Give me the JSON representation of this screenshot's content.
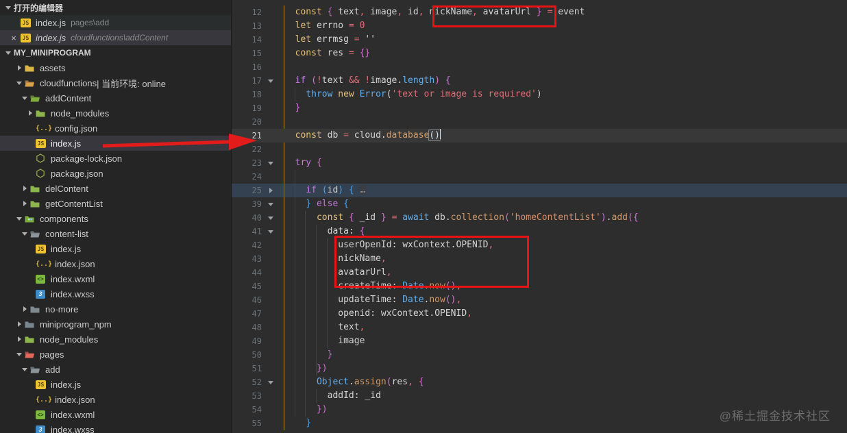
{
  "watermark": "@稀土掘金技术社区",
  "sidebar": {
    "open_editors_header": "打开的编辑器",
    "project_header": "MY_MINIPROGRAM",
    "open_editors": [
      {
        "file": "index.js",
        "path": "pages\\add",
        "icon": "js-file-icon",
        "active": false,
        "close_label": ""
      },
      {
        "file": "index.js",
        "path": "cloudfunctions\\addContent",
        "icon": "js-file-icon",
        "active": true,
        "close_label": "×"
      }
    ],
    "tree": [
      {
        "label": "assets",
        "icon": "folder-icon",
        "color": "#dcb549",
        "indent": 1,
        "chevron": "collapsed"
      },
      {
        "label": "cloudfunctions",
        "suffix": " | 当前环境: online",
        "icon": "folder-open-icon",
        "color": "#d9a04a",
        "indent": 1,
        "chevron": "expanded"
      },
      {
        "label": "addContent",
        "icon": "folder-open-icon",
        "color": "#7fae3e",
        "indent": 2,
        "chevron": "expanded"
      },
      {
        "label": "node_modules",
        "icon": "folder-icon",
        "color": "#8db54e",
        "indent": 3,
        "chevron": "collapsed"
      },
      {
        "label": "config.json",
        "icon": "json-file-icon",
        "indent": 3
      },
      {
        "label": "index.js",
        "icon": "js-file-icon",
        "indent": 3,
        "selected": true
      },
      {
        "label": "package-lock.json",
        "icon": "npm-package-icon",
        "indent": 3
      },
      {
        "label": "package.json",
        "icon": "npm-package-icon",
        "indent": 3
      },
      {
        "label": "delContent",
        "icon": "folder-icon",
        "color": "#8db54e",
        "indent": 2,
        "chevron": "collapsed"
      },
      {
        "label": "getContentList",
        "icon": "folder-icon",
        "color": "#8db54e",
        "indent": 2,
        "chevron": "collapsed"
      },
      {
        "label": "components",
        "icon": "folder-components-icon",
        "color": "#7cae3e",
        "indent": 1,
        "chevron": "expanded"
      },
      {
        "label": "content-list",
        "icon": "folder-open-icon",
        "color": "#8a9499",
        "indent": 2,
        "chevron": "expanded"
      },
      {
        "label": "index.js",
        "icon": "js-file-icon",
        "indent": 3
      },
      {
        "label": "index.json",
        "icon": "json-file-icon",
        "indent": 3
      },
      {
        "label": "index.wxml",
        "icon": "wxml-file-icon",
        "indent": 3
      },
      {
        "label": "index.wxss",
        "icon": "wxss-file-icon",
        "indent": 3
      },
      {
        "label": "no-more",
        "icon": "folder-icon",
        "color": "#7f8a90",
        "indent": 2,
        "chevron": "collapsed"
      },
      {
        "label": "miniprogram_npm",
        "icon": "folder-icon",
        "color": "#77858f",
        "indent": 1,
        "chevron": "collapsed"
      },
      {
        "label": "node_modules",
        "icon": "folder-icon",
        "color": "#8db54e",
        "indent": 1,
        "chevron": "collapsed"
      },
      {
        "label": "pages",
        "icon": "folder-open-icon",
        "color": "#e2695a",
        "indent": 1,
        "chevron": "expanded"
      },
      {
        "label": "add",
        "icon": "folder-open-icon",
        "color": "#8a9499",
        "indent": 2,
        "chevron": "expanded"
      },
      {
        "label": "index.js",
        "icon": "js-file-icon",
        "indent": 3
      },
      {
        "label": "index.json",
        "icon": "json-file-icon",
        "indent": 3
      },
      {
        "label": "index.wxml",
        "icon": "wxml-file-icon",
        "indent": 3
      },
      {
        "label": "index.wxss",
        "icon": "wxss-file-icon",
        "indent": 3
      }
    ]
  },
  "editor": {
    "lines": [
      {
        "n": "12",
        "s": [
          [
            "  ",
            "pl"
          ],
          [
            "const",
            "kw"
          ],
          [
            " ",
            "pl"
          ],
          [
            "{",
            "bp"
          ],
          [
            " text",
            "va"
          ],
          [
            ",",
            "op"
          ],
          [
            " image",
            "va"
          ],
          [
            ",",
            "op"
          ],
          [
            " id",
            "va"
          ],
          [
            ",",
            "op"
          ],
          [
            " nickName",
            "va"
          ],
          [
            ",",
            "op"
          ],
          [
            " avatarUrl ",
            "va"
          ],
          [
            "}",
            "bp"
          ],
          [
            " ",
            "pl"
          ],
          [
            "=",
            "op"
          ],
          [
            " event",
            "va"
          ]
        ]
      },
      {
        "n": "13",
        "s": [
          [
            "  ",
            "pl"
          ],
          [
            "let",
            "kw"
          ],
          [
            " errno ",
            "va"
          ],
          [
            "=",
            "op"
          ],
          [
            " ",
            "pl"
          ],
          [
            "0",
            "op"
          ]
        ]
      },
      {
        "n": "14",
        "s": [
          [
            "  ",
            "pl"
          ],
          [
            "let",
            "kw"
          ],
          [
            " errmsg ",
            "va"
          ],
          [
            "=",
            "op"
          ],
          [
            " ''",
            "va"
          ]
        ]
      },
      {
        "n": "15",
        "s": [
          [
            "  ",
            "pl"
          ],
          [
            "const",
            "kw"
          ],
          [
            " res ",
            "va"
          ],
          [
            "=",
            "op"
          ],
          [
            " ",
            "pl"
          ],
          [
            "{}",
            "bp"
          ]
        ]
      },
      {
        "n": "16",
        "s": []
      },
      {
        "n": "17",
        "fold": "v",
        "s": [
          [
            "  ",
            "pl"
          ],
          [
            "if",
            "kp"
          ],
          [
            " ",
            "pl"
          ],
          [
            "(",
            "bp"
          ],
          [
            "!",
            "op"
          ],
          [
            "text ",
            "va"
          ],
          [
            "&&",
            "op"
          ],
          [
            " ",
            "pl"
          ],
          [
            "!",
            "op"
          ],
          [
            "image",
            "va"
          ],
          [
            ".",
            "va"
          ],
          [
            "length",
            "cl"
          ],
          [
            ")",
            "bp"
          ],
          [
            " ",
            "pl"
          ],
          [
            "{",
            "bp"
          ]
        ]
      },
      {
        "n": "18",
        "s": [
          [
            "    ",
            "pl"
          ],
          [
            "throw",
            "kb"
          ],
          [
            " ",
            "pl"
          ],
          [
            "new",
            "kw"
          ],
          [
            " ",
            "pl"
          ],
          [
            "Error",
            "cl"
          ],
          [
            "(",
            "va"
          ],
          [
            "'text or image is required'",
            "st"
          ],
          [
            ")",
            "va"
          ]
        ]
      },
      {
        "n": "19",
        "s": [
          [
            "  ",
            "pl"
          ],
          [
            "}",
            "bp"
          ]
        ]
      },
      {
        "n": "20",
        "s": []
      },
      {
        "n": "21",
        "current": true,
        "caret": true,
        "s": [
          [
            "  ",
            "pl"
          ],
          [
            "const",
            "kw"
          ],
          [
            " db ",
            "va"
          ],
          [
            "=",
            "op"
          ],
          [
            " cloud",
            "va"
          ],
          [
            ".",
            "va"
          ],
          [
            "database",
            "fn"
          ],
          [
            "()",
            "match"
          ]
        ]
      },
      {
        "n": "22",
        "s": []
      },
      {
        "n": "23",
        "fold": "v",
        "s": [
          [
            "  ",
            "pl"
          ],
          [
            "try",
            "kp"
          ],
          [
            " ",
            "pl"
          ],
          [
            "{",
            "bp"
          ]
        ]
      },
      {
        "n": "24",
        "s": []
      },
      {
        "n": "25",
        "fold": "r",
        "folded": true,
        "s": [
          [
            "    ",
            "pl"
          ],
          [
            "if",
            "kp"
          ],
          [
            " ",
            "pl"
          ],
          [
            "(",
            "bb"
          ],
          [
            "id",
            "va"
          ],
          [
            ")",
            "bb"
          ],
          [
            " ",
            "pl"
          ],
          [
            "{",
            "bb"
          ],
          [
            " ",
            "pl"
          ],
          [
            "…",
            "fold-el"
          ]
        ]
      },
      {
        "n": "39",
        "fold": "v",
        "s": [
          [
            "    ",
            "pl"
          ],
          [
            "}",
            "bb"
          ],
          [
            " ",
            "pl"
          ],
          [
            "else",
            "kp"
          ],
          [
            " ",
            "pl"
          ],
          [
            "{",
            "bb"
          ]
        ]
      },
      {
        "n": "40",
        "fold": "v",
        "s": [
          [
            "      ",
            "pl"
          ],
          [
            "const",
            "kw"
          ],
          [
            " ",
            "pl"
          ],
          [
            "{",
            "bp"
          ],
          [
            " _id ",
            "va"
          ],
          [
            "}",
            "bp"
          ],
          [
            " ",
            "pl"
          ],
          [
            "=",
            "op"
          ],
          [
            " ",
            "pl"
          ],
          [
            "await",
            "kb"
          ],
          [
            " db",
            "va"
          ],
          [
            ".",
            "va"
          ],
          [
            "collection",
            "fn"
          ],
          [
            "(",
            "bp"
          ],
          [
            "'homeContentList'",
            "st2"
          ],
          [
            ")",
            "bp"
          ],
          [
            ".",
            "va"
          ],
          [
            "add",
            "fn"
          ],
          [
            "(",
            "bp"
          ],
          [
            "{",
            "bp"
          ]
        ]
      },
      {
        "n": "41",
        "fold": "v",
        "s": [
          [
            "        ",
            "pl"
          ],
          [
            "data",
            "va"
          ],
          [
            ":",
            "va"
          ],
          [
            " ",
            "pl"
          ],
          [
            "{",
            "bp"
          ]
        ]
      },
      {
        "n": "42",
        "s": [
          [
            "          ",
            "pl"
          ],
          [
            "userOpenId",
            "va"
          ],
          [
            ":",
            "va"
          ],
          [
            " wxContext",
            "va"
          ],
          [
            ".",
            "va"
          ],
          [
            "OPENID",
            "va"
          ],
          [
            ",",
            "op"
          ]
        ]
      },
      {
        "n": "43",
        "s": [
          [
            "          ",
            "pl"
          ],
          [
            "nickName",
            "va"
          ],
          [
            ",",
            "op"
          ]
        ]
      },
      {
        "n": "44",
        "s": [
          [
            "          ",
            "pl"
          ],
          [
            "avatarUrl",
            "va"
          ],
          [
            ",",
            "op"
          ]
        ]
      },
      {
        "n": "45",
        "s": [
          [
            "          ",
            "pl"
          ],
          [
            "createTime",
            "va"
          ],
          [
            ":",
            "va"
          ],
          [
            " ",
            "pl"
          ],
          [
            "Date",
            "cl"
          ],
          [
            ".",
            "va"
          ],
          [
            "now",
            "fn"
          ],
          [
            "()",
            "bp"
          ],
          [
            ",",
            "op"
          ]
        ]
      },
      {
        "n": "46",
        "s": [
          [
            "          ",
            "pl"
          ],
          [
            "updateTime",
            "va"
          ],
          [
            ":",
            "va"
          ],
          [
            " ",
            "pl"
          ],
          [
            "Date",
            "cl"
          ],
          [
            ".",
            "va"
          ],
          [
            "now",
            "fn"
          ],
          [
            "()",
            "bp"
          ],
          [
            ",",
            "op"
          ]
        ]
      },
      {
        "n": "47",
        "s": [
          [
            "          ",
            "pl"
          ],
          [
            "openid",
            "va"
          ],
          [
            ":",
            "va"
          ],
          [
            " wxContext",
            "va"
          ],
          [
            ".",
            "va"
          ],
          [
            "OPENID",
            "va"
          ],
          [
            ",",
            "op"
          ]
        ]
      },
      {
        "n": "48",
        "s": [
          [
            "          ",
            "pl"
          ],
          [
            "text",
            "va"
          ],
          [
            ",",
            "op"
          ]
        ]
      },
      {
        "n": "49",
        "s": [
          [
            "          ",
            "pl"
          ],
          [
            "image",
            "va"
          ]
        ]
      },
      {
        "n": "50",
        "s": [
          [
            "        ",
            "pl"
          ],
          [
            "}",
            "bp"
          ]
        ]
      },
      {
        "n": "51",
        "s": [
          [
            "      ",
            "pl"
          ],
          [
            "})",
            "bp"
          ]
        ]
      },
      {
        "n": "52",
        "fold": "v",
        "s": [
          [
            "      ",
            "pl"
          ],
          [
            "Object",
            "cl"
          ],
          [
            ".",
            "va"
          ],
          [
            "assign",
            "fn"
          ],
          [
            "(",
            "bp"
          ],
          [
            "res",
            "va"
          ],
          [
            ",",
            "op"
          ],
          [
            " ",
            "pl"
          ],
          [
            "{",
            "bp"
          ]
        ]
      },
      {
        "n": "53",
        "s": [
          [
            "        ",
            "pl"
          ],
          [
            "addId",
            "va"
          ],
          [
            ":",
            "va"
          ],
          [
            " _id",
            "va"
          ]
        ]
      },
      {
        "n": "54",
        "s": [
          [
            "      ",
            "pl"
          ],
          [
            "})",
            "bp"
          ]
        ]
      },
      {
        "n": "55",
        "s": [
          [
            "    ",
            "pl"
          ],
          [
            "}",
            "bb"
          ]
        ]
      }
    ]
  }
}
